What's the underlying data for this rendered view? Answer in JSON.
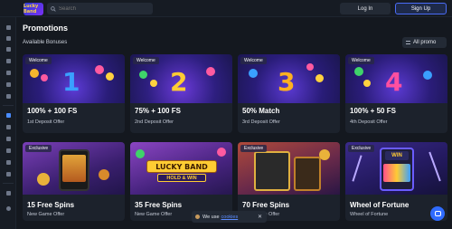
{
  "header": {
    "logo_text": "Lucky Band",
    "search_placeholder": "Search",
    "login_label": "Log In",
    "signup_label": "Sign Up"
  },
  "page": {
    "title": "Promotions",
    "section_label": "Available Bonuses",
    "filter_label": "All promo"
  },
  "row1": [
    {
      "tag": "Welcome",
      "title": "100% + 100 FS",
      "sub": "1st Deposit Offer",
      "number": "1",
      "num_color": "#3aa0ff"
    },
    {
      "tag": "Welcome",
      "title": "75% + 100 FS",
      "sub": "2nd Deposit Offer",
      "number": "2",
      "num_color": "#ffcc33"
    },
    {
      "tag": "Welcome",
      "title": "50% Match",
      "sub": "3rd Deposit Offer",
      "number": "3",
      "num_color": "#ffb020"
    },
    {
      "tag": "Welcome",
      "title": "100% + 50 FS",
      "sub": "4th Deposit Offer",
      "number": "4",
      "num_color": "#ff4fa0"
    }
  ],
  "row2": [
    {
      "tag": "Exclusive",
      "title": "15 Free Spins",
      "sub": "New Game Offer"
    },
    {
      "tag": "",
      "title": "35 Free Spins",
      "sub": "New Game Offer",
      "banner_top": "LUCKY BAND",
      "banner_bottom": "HOLD & WIN"
    },
    {
      "tag": "Exclusive",
      "title": "70 Free Spins",
      "sub": "New Game Offer"
    },
    {
      "tag": "Exclusive",
      "title": "Wheel of Fortune",
      "sub": "Wheel of Fortune",
      "banner_top": "WIN"
    }
  ],
  "cookie": {
    "text": "We use",
    "link": "cookies",
    "close": "✕"
  },
  "icons": {
    "search": "search-icon",
    "filter": "filter-icon",
    "chat": "chat-icon",
    "close": "close-icon"
  },
  "colors": {
    "background": "#14181f",
    "card": "#1c222c",
    "accent": "#4a6cf7",
    "chat": "#2f6bff"
  }
}
